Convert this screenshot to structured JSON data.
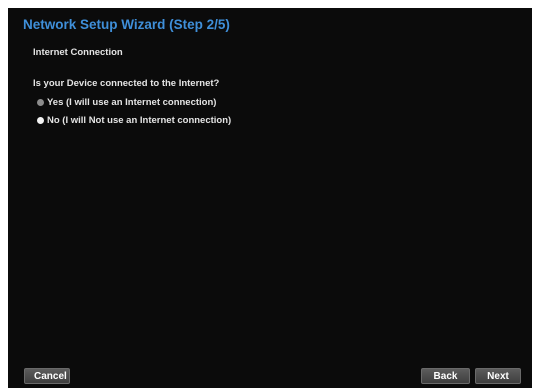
{
  "wizard": {
    "title": "Network Setup Wizard (Step 2/5)",
    "section_label": "Internet Connection",
    "question": "Is your Device connected to the Internet?",
    "options": [
      {
        "label": "Yes (I will use an Internet connection)",
        "selected": true
      },
      {
        "label": "No (I will Not use an Internet connection)",
        "selected": false
      }
    ]
  },
  "buttons": {
    "cancel": "Cancel",
    "back": "Back",
    "next": "Next"
  },
  "colors": {
    "title": "#3f8fd9",
    "background": "#0b0b0b",
    "radio_selected": "#8c8c8c",
    "radio_unselected": "#f2f2f2"
  }
}
